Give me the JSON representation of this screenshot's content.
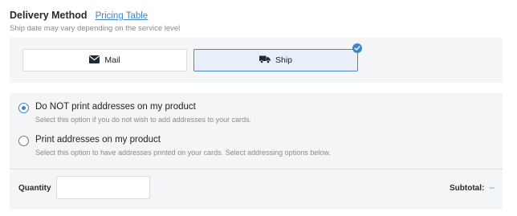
{
  "header": {
    "title": "Delivery Method",
    "pricing_link": "Pricing Table",
    "subtitle": "Ship date may vary depending on the service level"
  },
  "delivery_methods": {
    "selected": "Ship",
    "items": [
      {
        "label": "Mail",
        "icon": "envelope-icon"
      },
      {
        "label": "Ship",
        "icon": "truck-icon"
      }
    ]
  },
  "address_options": {
    "selected": "Do NOT print addresses on my product",
    "items": [
      {
        "label": "Do NOT print addresses on my product",
        "description": "Select this option if you do not wish to add addresses to your cards."
      },
      {
        "label": "Print addresses on my product",
        "description": "Select this option to have addresses printed on your cards. Select addressing options below."
      }
    ]
  },
  "quantity": {
    "label": "Quantity",
    "value": "",
    "placeholder": ""
  },
  "subtotal": {
    "label": "Subtotal:",
    "value": "--"
  },
  "colors": {
    "accent": "#3f83c8",
    "link": "#3d86c6",
    "panel_bg": "#f4f5f7",
    "selected_bg": "#e8eff9"
  }
}
